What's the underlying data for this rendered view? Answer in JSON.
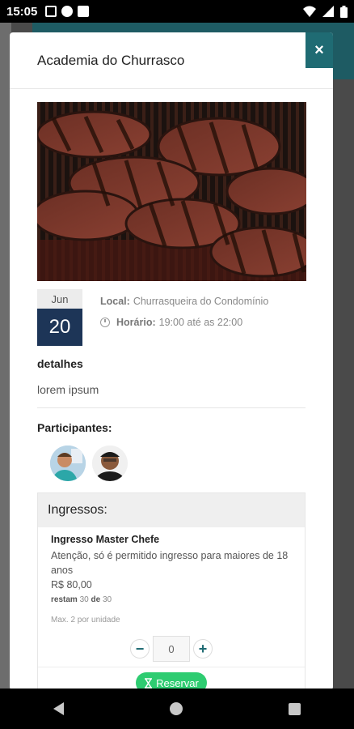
{
  "status_bar": {
    "time": "15:05"
  },
  "modal": {
    "title": "Academia do Churrasco",
    "close_label": "×"
  },
  "event": {
    "month": "Jun",
    "day": "20",
    "local_label": "Local:",
    "local_value": "Churrasqueira do Condomínio",
    "time_label": "Horário:",
    "time_value": "19:00 até as 22:00",
    "details_label": "detalhes",
    "details_text": "lorem ipsum",
    "participants_label": "Participantes:"
  },
  "tickets": {
    "header": "Ingressos:",
    "items": [
      {
        "name": "Ingresso Master Chefe",
        "warning": "Atenção, só é permitido ingresso para maiores de 18 anos",
        "price": "R$ 80,00",
        "remain_label": "restam",
        "remain": "30",
        "of_label": "de",
        "total": "30",
        "max": "Max. 2 por unidade",
        "quantity": "0"
      }
    ],
    "reserve_label": "Reservar"
  },
  "colors": {
    "accent": "#1f6b73",
    "date_bg": "#1d3557",
    "reserve": "#2ecc71"
  }
}
